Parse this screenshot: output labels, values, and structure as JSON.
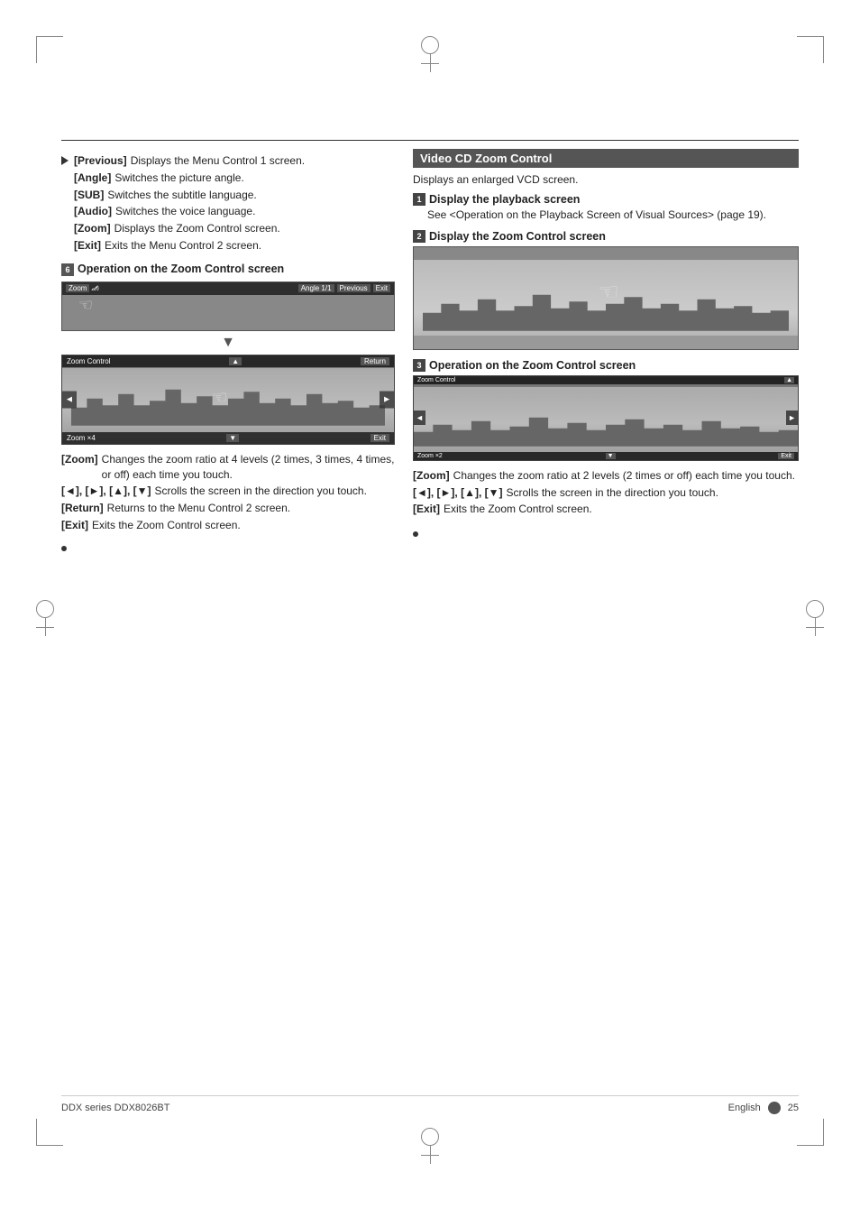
{
  "page": {
    "footer_left": "DDX series  DDX8026BT",
    "footer_right": "English",
    "page_number": "25"
  },
  "left_column": {
    "items": [
      {
        "key": "[Previous]",
        "text": "Displays the Menu Control 1 screen."
      },
      {
        "key": "[Angle]",
        "text": "Switches the picture angle."
      },
      {
        "key": "[SUB]",
        "text": "Switches the subtitle language."
      },
      {
        "key": "[Audio]",
        "text": "Switches the voice language."
      },
      {
        "key": "[Zoom]",
        "text": "Displays the Zoom Control screen."
      },
      {
        "key": "[Exit]",
        "text": "Exits the Menu Control 2 screen."
      }
    ],
    "section6": {
      "num": "6",
      "title": "Operation on the Zoom Control screen",
      "zoom_items": [
        {
          "key": "[Zoom]",
          "text": "Changes the zoom ratio at 4 levels (2 times, 3 times, 4 times, or off) each time you touch."
        },
        {
          "key": "[◄], [►], [▲], [▼]",
          "text": "Scrolls the screen in the direction you touch."
        },
        {
          "key": "[Return]",
          "text": "Returns to the Menu Control 2 screen."
        },
        {
          "key": "[Exit]",
          "text": "Exits the Zoom Control screen."
        }
      ]
    }
  },
  "right_column": {
    "header": "Video CD Zoom Control",
    "subtitle": "Displays an enlarged VCD screen.",
    "step1": {
      "num": "1",
      "title": "Display the playback screen",
      "text": "See <Operation on the Playback Screen of Visual Sources> (page 19)."
    },
    "step2": {
      "num": "2",
      "title": "Display the Zoom Control screen"
    },
    "step3": {
      "num": "3",
      "title": "Operation on the Zoom Control screen",
      "zoom_items": [
        {
          "key": "[Zoom]",
          "text": "Changes the zoom ratio at 2 levels (2 times or off) each time you touch."
        },
        {
          "key": "[◄], [►], [▲], [▼]",
          "text": "Scrolls the screen in the direction you touch."
        },
        {
          "key": "[Exit]",
          "text": "Exits the Zoom Control screen."
        }
      ]
    }
  },
  "ui_labels": {
    "zoom_control": "Zoom Control",
    "return_btn": "Return",
    "exit_btn": "Exit",
    "angle_btn": "Angle 1/1",
    "previous_btn": "Previous",
    "zoom_label": "Zoom ×4",
    "zoom_label2": "Zoom ×2",
    "up_arrow": "▲",
    "left_arrow": "◄",
    "right_arrow": "►",
    "down_arrow": "▼"
  }
}
